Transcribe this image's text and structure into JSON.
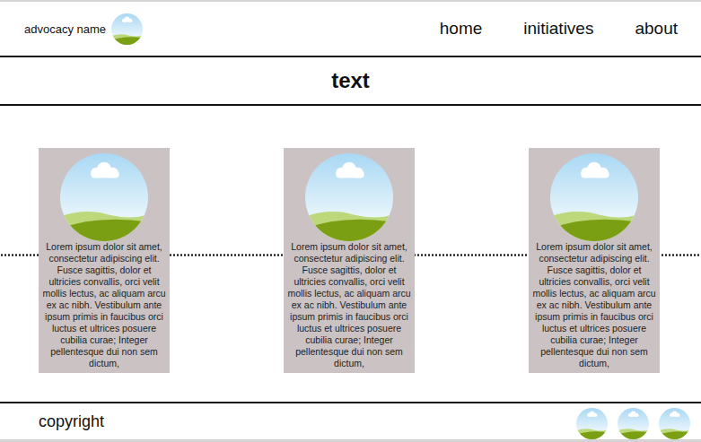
{
  "header": {
    "brand": "advocacy name",
    "nav": [
      "home",
      "initiatives",
      "about"
    ]
  },
  "title": "text",
  "cards": [
    {
      "text": "Lorem ipsum dolor sit amet, consectetur adipiscing elit. Fusce sagittis, dolor et ultricies convallis, orci velit mollis lectus, ac aliquam arcu ex ac nibh. Vestibulum ante ipsum primis in faucibus orci luctus et ultrices posuere cubilia curae; Integer pellentesque dui non sem dictum,"
    },
    {
      "text": "Lorem ipsum dolor sit amet, consectetur adipiscing elit. Fusce sagittis, dolor et ultricies convallis, orci velit mollis lectus, ac aliquam arcu ex ac nibh. Vestibulum ante ipsum primis in faucibus orci luctus et ultrices posuere cubilia curae; Integer pellentesque dui non sem dictum,"
    },
    {
      "text": "Lorem ipsum dolor sit amet, consectetur adipiscing elit. Fusce sagittis, dolor et ultricies convallis, orci velit mollis lectus, ac aliquam arcu ex ac nibh. Vestibulum ante ipsum primis in faucibus orci luctus et ultrices posuere cubilia curae; Integer pellentesque dui non sem dictum,"
    }
  ],
  "footer": {
    "copyright": "copyright"
  }
}
